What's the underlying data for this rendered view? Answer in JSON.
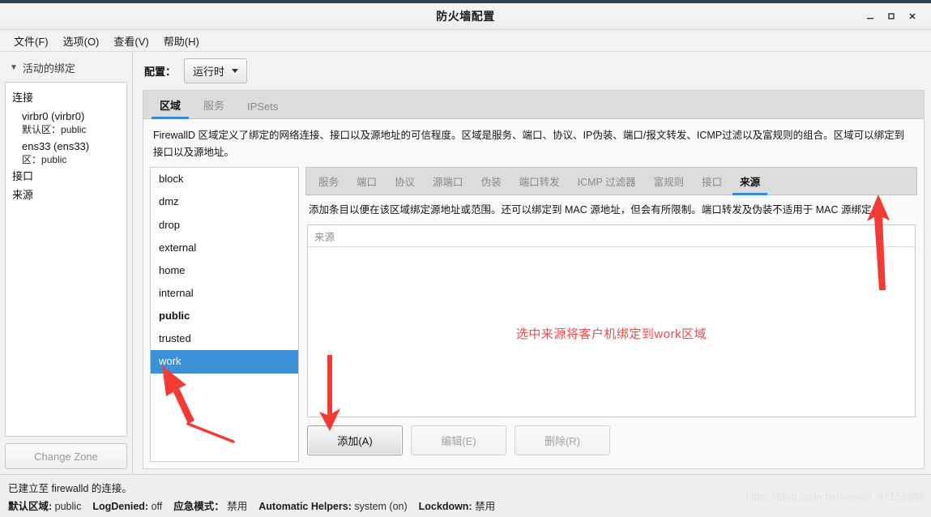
{
  "window": {
    "title": "防火墙配置",
    "buttons": {
      "minimize": "minimize",
      "maximize": "maximize",
      "close": "close"
    }
  },
  "menubar": {
    "items": [
      {
        "label": "文件(F)"
      },
      {
        "label": "选项(O)"
      },
      {
        "label": "查看(V)"
      },
      {
        "label": "帮助(H)"
      }
    ]
  },
  "sidebar": {
    "header": "活动的绑定",
    "tree": {
      "connections_label": "连接",
      "connections": [
        {
          "name": "virbr0 (virbr0)",
          "zone_label": "默认区",
          "zone_sep": "：",
          "zone_value": "public"
        },
        {
          "name": "ens33 (ens33)",
          "zone_label": "区",
          "zone_sep": "：",
          "zone_value": "public"
        }
      ],
      "interfaces_label": "接口",
      "sources_label": "来源"
    },
    "change_zone_button": "Change Zone"
  },
  "toolbar": {
    "config_label": "配置：",
    "config_value": "运行时"
  },
  "main_tabs": [
    {
      "label": "区域",
      "active": true
    },
    {
      "label": "服务",
      "active": false
    },
    {
      "label": "IPSets",
      "active": false
    }
  ],
  "zone_description": "FirewallD 区域定义了绑定的网络连接、接口以及源地址的可信程度。区域是服务、端口、协议、IP伪装、端口/报文转发、ICMP过滤以及富规则的组合。区域可以绑定到接口以及源地址。",
  "zone_list": [
    {
      "name": "block",
      "selected": false,
      "default": false
    },
    {
      "name": "dmz",
      "selected": false,
      "default": false
    },
    {
      "name": "drop",
      "selected": false,
      "default": false
    },
    {
      "name": "external",
      "selected": false,
      "default": false
    },
    {
      "name": "home",
      "selected": false,
      "default": false
    },
    {
      "name": "internal",
      "selected": false,
      "default": false
    },
    {
      "name": "public",
      "selected": false,
      "default": true
    },
    {
      "name": "trusted",
      "selected": false,
      "default": false
    },
    {
      "name": "work",
      "selected": true,
      "default": false
    }
  ],
  "zone_sub_tabs": [
    {
      "label": "服务",
      "active": false
    },
    {
      "label": "端口",
      "active": false
    },
    {
      "label": "协议",
      "active": false
    },
    {
      "label": "源端口",
      "active": false
    },
    {
      "label": "伪装",
      "active": false
    },
    {
      "label": "端口转发",
      "active": false
    },
    {
      "label": "ICMP 过滤器",
      "active": false
    },
    {
      "label": "富规则",
      "active": false
    },
    {
      "label": "接口",
      "active": false
    },
    {
      "label": "来源",
      "active": true
    }
  ],
  "sources_panel": {
    "description": "添加条目以便在该区域绑定源地址或范围。还可以绑定到 MAC 源地址，但会有所限制。端口转发及伪装不适用于 MAC 源绑定。",
    "table_header": "来源",
    "rows": [],
    "buttons": {
      "add": "添加(A)",
      "edit": "编辑(E)",
      "remove": "删除(R)"
    }
  },
  "annotations": {
    "note_text": "选中来源将客户机绑定到work区域",
    "note_color": "#f2494a",
    "arrow_color": "#f33b36"
  },
  "statusbar": {
    "connection_text": "已建立至 firewalld 的连接。",
    "fields": [
      {
        "label": "默认区域:",
        "value": "public"
      },
      {
        "label": "LogDenied:",
        "value": "off"
      },
      {
        "label": "应急模式：",
        "value": "禁用"
      },
      {
        "label": "Automatic Helpers:",
        "value": "system (on)"
      },
      {
        "label": "Lockdown:",
        "value": "禁用"
      }
    ]
  },
  "watermark": "https://blog.csdn.net/weixin_47153988",
  "theme": {
    "accent": "#3b87d8",
    "selection": "#3d8fd6",
    "titlebar_top": "#2b4355"
  }
}
